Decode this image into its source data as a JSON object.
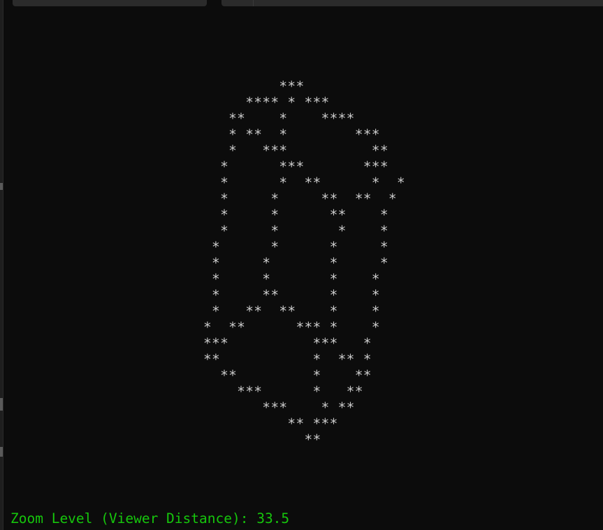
{
  "terminal": {
    "ascii_art": [
      "         ***",
      "     **** * ***",
      "   **    *    ****",
      "   * **  *        ***",
      "   *   ***          **",
      "  *      ***       ***",
      "  *      *  **      *  *",
      "  *     *     **  **  *",
      "  *     *      **    *",
      "  *     *       *    *",
      " *      *      *     *",
      " *     *       *     *",
      " *     *       *    *",
      " *     **      *    *",
      " *   **  **    *    *",
      "*  **      *** *    *",
      "***          ***   *",
      "**           *  ** *",
      "  **         *    **",
      "    ***      *   **",
      "       ***    * **",
      "          ** ***",
      "            **"
    ],
    "status_line": "Zoom Level (Viewer Distance): 33.5"
  },
  "colors": {
    "background": "#0c0c0c",
    "ascii_text": "#cccccc",
    "status_text": "#16c60c"
  }
}
